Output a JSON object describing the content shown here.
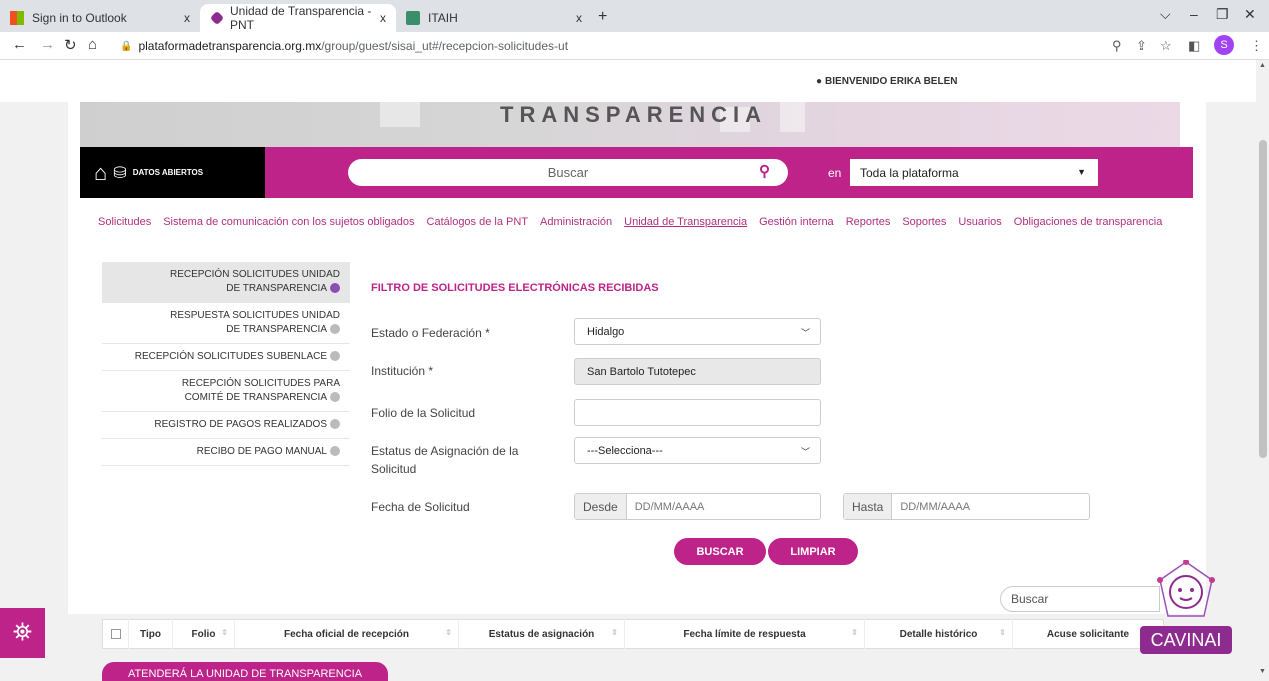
{
  "browser": {
    "tabs": [
      {
        "title": "Sign in to Outlook",
        "close": "x"
      },
      {
        "title": "Unidad de Transparencia - PNT",
        "close": "x"
      },
      {
        "title": "ITAIH",
        "close": "x"
      }
    ],
    "new_tab": "+",
    "url_host": "plataformadetransparencia.org.mx",
    "url_path": "/group/guest/sisai_ut#/recepcion-solicitudes-ut",
    "profile_initial": "S"
  },
  "header": {
    "welcome": "BIENVENIDO ERIKA BELEN",
    "banner_text": "TRANSPARENCIA",
    "datos_abiertos": "DATOS ABIERTOS",
    "search_placeholder": "Buscar",
    "en_label": "en",
    "scope_value": "Toda la plataforma"
  },
  "menu": [
    "Solicitudes",
    "Sistema de comunicación con los sujetos obligados",
    "Catálogos de la PNT",
    "Administración",
    "Unidad de Transparencia",
    "Gestión interna",
    "Reportes",
    "Soportes",
    "Usuarios",
    "Obligaciones de transparencia"
  ],
  "sidebar": [
    "RECEPCIÓN SOLICITUDES UNIDAD DE TRANSPARENCIA",
    "RESPUESTA SOLICITUDES UNIDAD DE TRANSPARENCIA",
    "RECEPCIÓN SOLICITUDES SUBENLACE",
    "RECEPCIÓN SOLICITUDES PARA COMITÉ DE TRANSPARENCIA",
    "REGISTRO DE PAGOS REALIZADOS",
    "RECIBO DE PAGO MANUAL"
  ],
  "form": {
    "title": "FILTRO DE SOLICITUDES ELECTRÓNICAS RECIBIDAS",
    "estado_label": "Estado o Federación *",
    "estado_value": "Hidalgo",
    "institucion_label": "Institución *",
    "institucion_value": "San Bartolo Tutotepec",
    "folio_label": "Folio de la Solicitud",
    "estatus_label": "Estatus de Asignación de la Solicitud",
    "estatus_value": "---Selecciona---",
    "fecha_label": "Fecha de Solicitud",
    "desde": "Desde",
    "hasta": "Hasta",
    "date_placeholder": "DD/MM/AAAA",
    "buscar_btn": "BUSCAR",
    "limpiar_btn": "LIMPIAR"
  },
  "table": {
    "search_placeholder": "Buscar",
    "columns": [
      "Tipo",
      "Folio",
      "Fecha oficial de recepción",
      "Estatus de asignación",
      "Fecha límite de respuesta",
      "Detalle histórico",
      "Acuse solicitante"
    ],
    "group_label": "ATENDERÁ LA UNIDAD DE TRANSPARENCIA"
  },
  "cavinai_label": "CAVINAI",
  "colors": {
    "brand_magenta": "#bd2389",
    "chrome_tabbar": "#dee1e6"
  }
}
